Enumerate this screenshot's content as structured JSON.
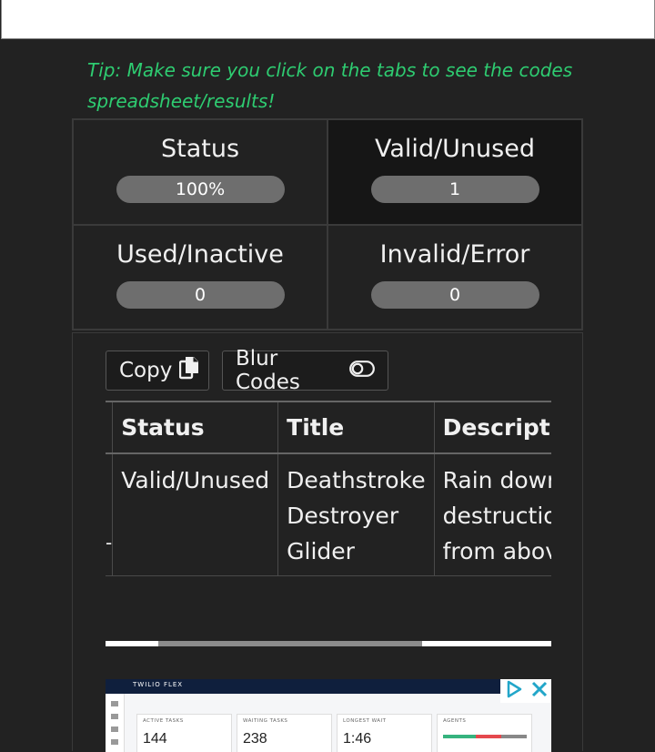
{
  "tip": "Tip: Make sure you click on the tabs to see the codes spreadsheet/results!",
  "stats": [
    {
      "label": "Status",
      "value": "100%"
    },
    {
      "label": "Valid/Unused",
      "value": "1"
    },
    {
      "label": "Used/Inactive",
      "value": "0"
    },
    {
      "label": "Invalid/Error",
      "value": "0"
    }
  ],
  "buttons": {
    "copy": "Copy",
    "blur": "Blur Codes"
  },
  "table": {
    "headers": [
      "Status",
      "Title",
      "Description"
    ],
    "rows": [
      {
        "marker": "-",
        "status": "Valid/Unused",
        "title": "Deathstroke Destroyer Glider",
        "description": "Rain down destruction from above."
      }
    ]
  },
  "ad": {
    "brand": "TWILIO FLEX",
    "kpis": [
      {
        "label": "ACTIVE TASKS",
        "value": "144"
      },
      {
        "label": "WAITING TASKS",
        "value": "238"
      },
      {
        "label": "LONGEST WAIT",
        "value": "1:46"
      },
      {
        "label": "AGENTS",
        "value": ""
      }
    ]
  },
  "colors": {
    "tip": "#2ecc71",
    "ad_play": "#22a6c9",
    "ad_close": "#22a6c9"
  }
}
